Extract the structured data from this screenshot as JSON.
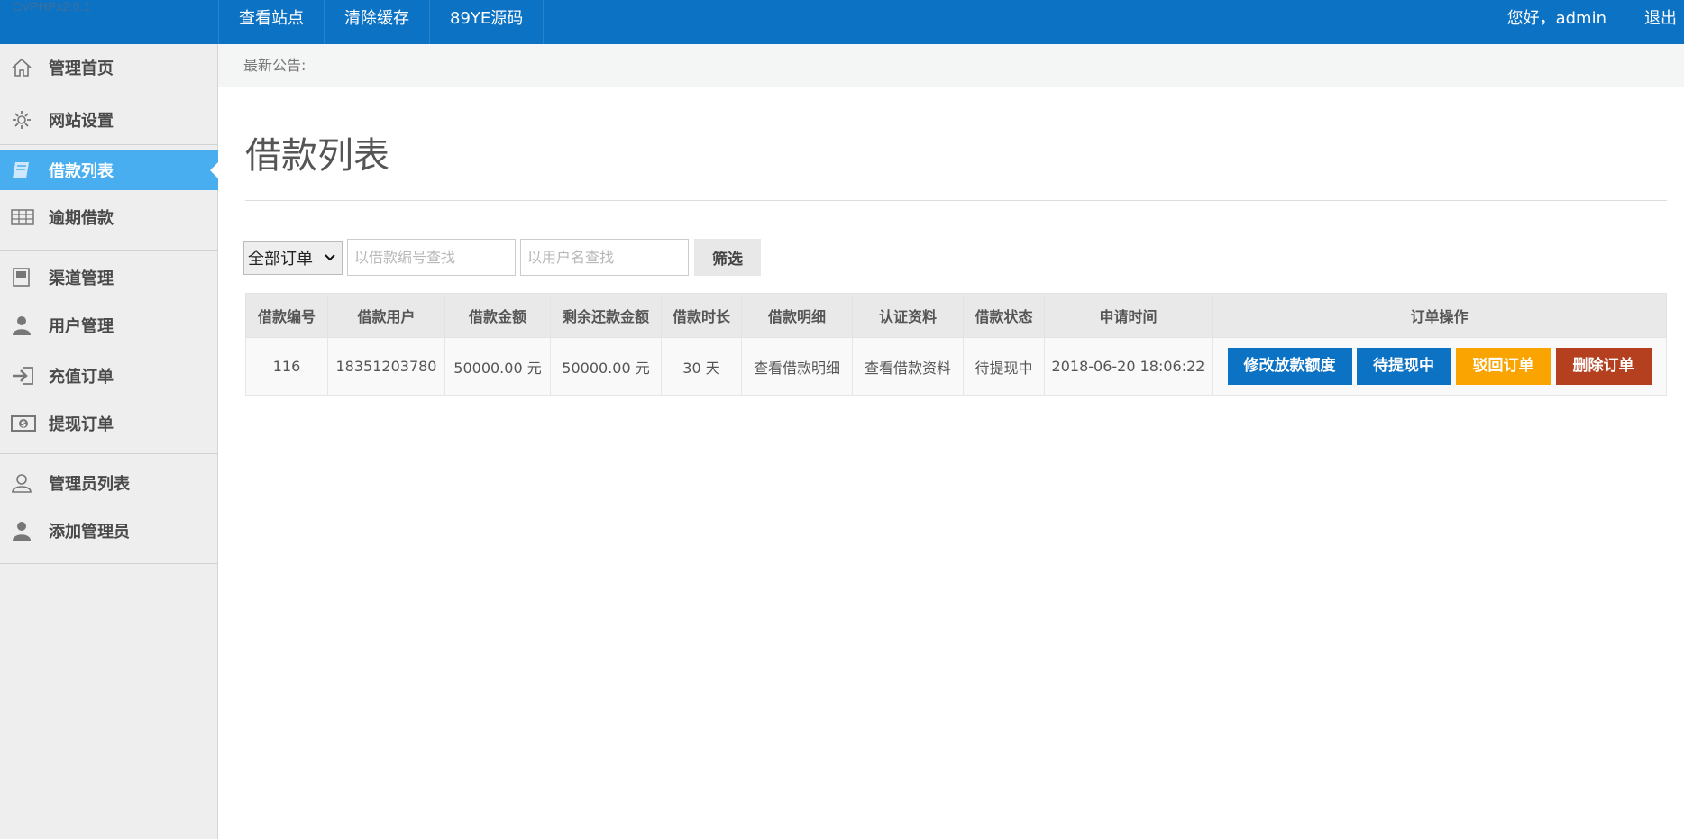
{
  "logo": "CVPHPx2.0.1",
  "topnav": [
    "查看站点",
    "清除缓存",
    "89YE源码"
  ],
  "user": {
    "greeting": "您好，admin",
    "logout": "退出"
  },
  "sidebar": [
    {
      "label": "管理首页",
      "icon": "home-icon"
    },
    {
      "label": "网站设置",
      "icon": "gear-icon"
    },
    {
      "label": "借款列表",
      "icon": "book-icon",
      "active": true
    },
    {
      "label": "逾期借款",
      "icon": "table-icon"
    },
    {
      "label": "渠道管理",
      "icon": "channel-icon"
    },
    {
      "label": "用户管理",
      "icon": "user-icon"
    },
    {
      "label": "充值订单",
      "icon": "login-icon"
    },
    {
      "label": "提现订单",
      "icon": "money-icon"
    },
    {
      "label": "管理员列表",
      "icon": "user-outline-icon"
    },
    {
      "label": "添加管理员",
      "icon": "user-icon"
    }
  ],
  "notice": "最新公告:",
  "page_title": "借款列表",
  "filter": {
    "select_value": "全部订单",
    "order_placeholder": "以借款编号查找",
    "user_placeholder": "以用户名查找",
    "button": "筛选"
  },
  "table": {
    "headers": [
      "借款编号",
      "借款用户",
      "借款金额",
      "剩余还款金额",
      "借款时长",
      "借款明细",
      "认证资料",
      "借款状态",
      "申请时间",
      "订单操作"
    ],
    "rows": [
      {
        "id": "116",
        "user": "18351203780",
        "amount": "50000.00 元",
        "remaining": "50000.00 元",
        "duration": "30 天",
        "detail": "查看借款明细",
        "auth": "查看借款资料",
        "status": "待提现中",
        "time": "2018-06-20 18:06:22",
        "actions": [
          "修改放款额度",
          "待提现中",
          "驳回订单",
          "删除订单"
        ]
      }
    ]
  },
  "colors": {
    "topbar": "#0c72c4",
    "active": "#49aef0",
    "orange": "#f9a400",
    "red": "#b5401f"
  }
}
